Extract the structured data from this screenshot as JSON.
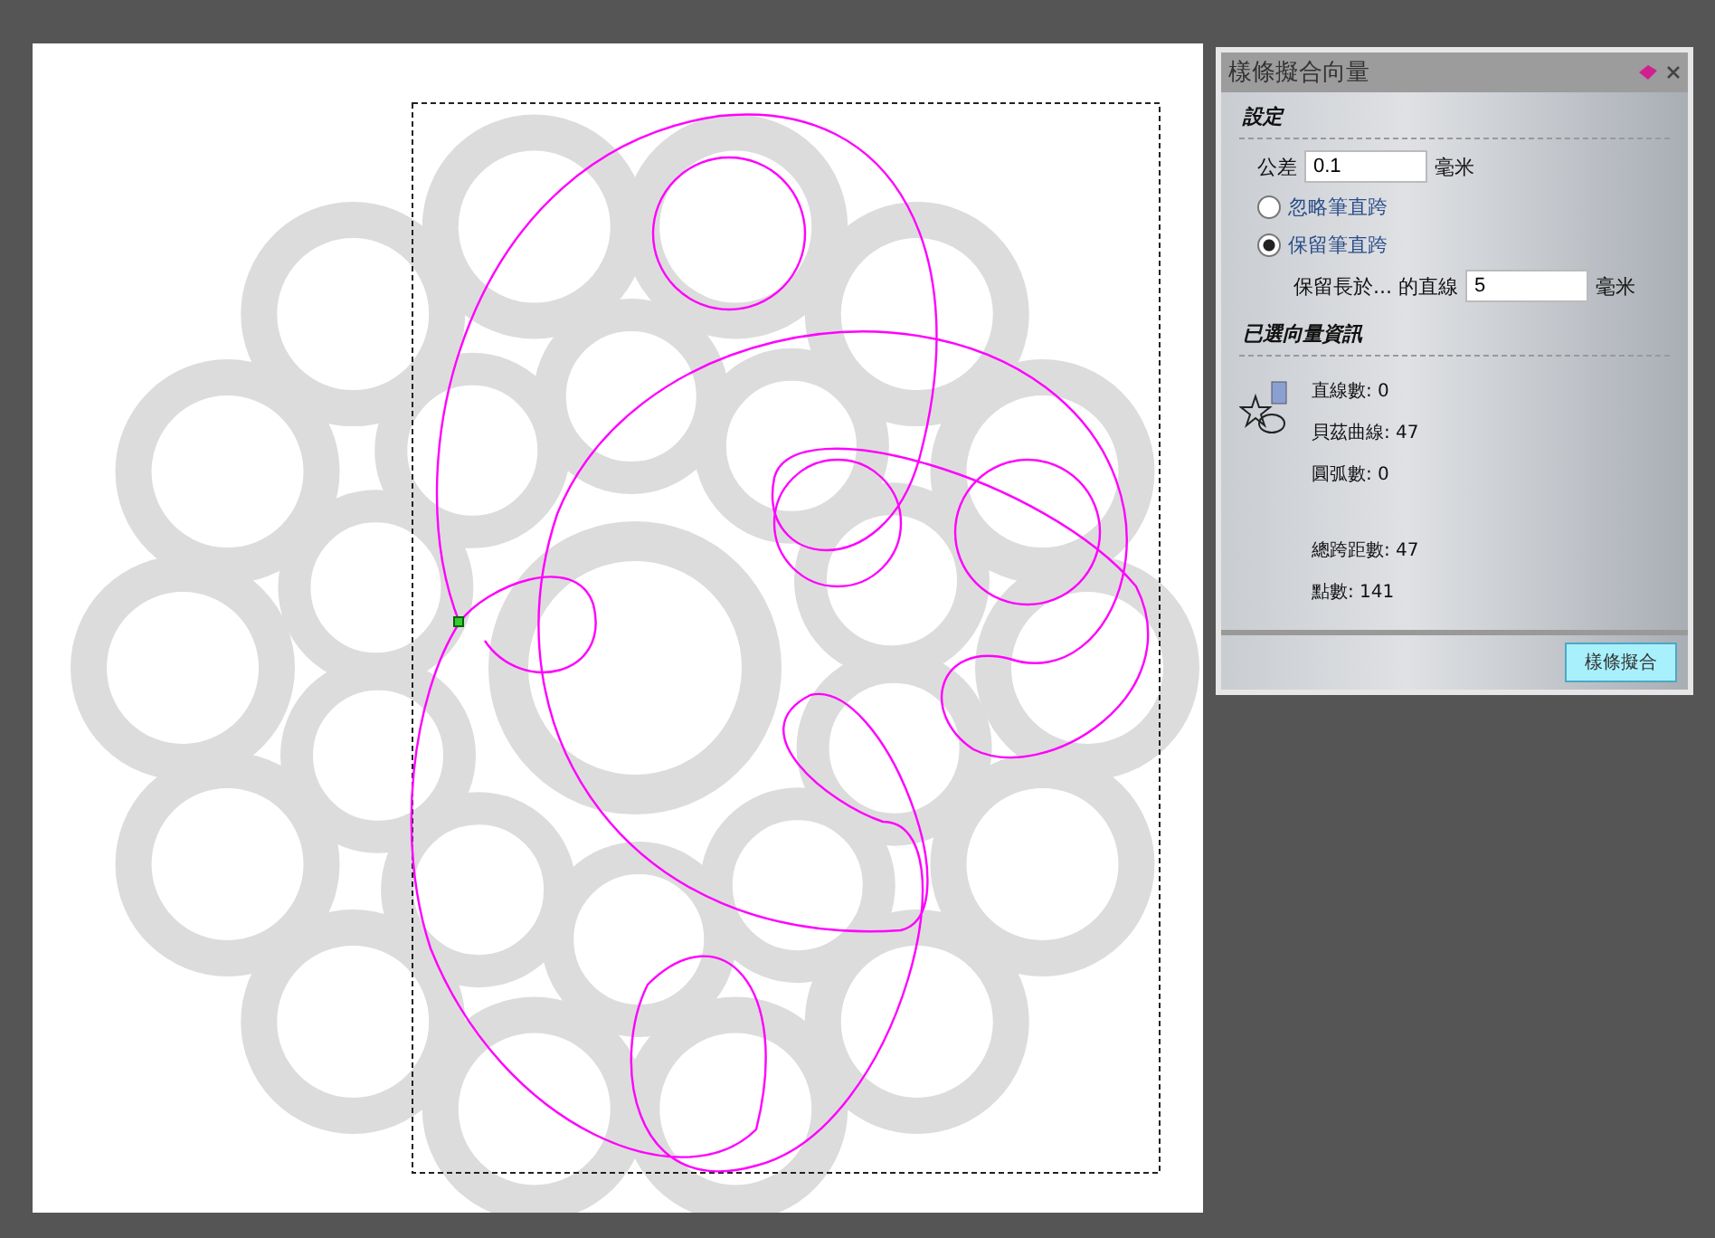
{
  "panel": {
    "title": "樣條擬合向量",
    "settings": {
      "heading": "設定",
      "tolerance": {
        "label": "公差",
        "value": "0.1",
        "unit": "毫米"
      },
      "options": [
        {
          "label": "忽略筆直跨",
          "selected": false
        },
        {
          "label": "保留筆直跨",
          "selected": true
        }
      ],
      "min_length": {
        "label": "保留長於... 的直線",
        "value": "5",
        "unit": "毫米"
      }
    },
    "info": {
      "heading": "已選向量資訊",
      "stats": [
        "直線數: 0",
        "貝茲曲線: 47",
        "圓弧數: 0"
      ],
      "totals": [
        "總跨距數: 47",
        "點數: 141"
      ]
    },
    "button": "樣條擬合"
  }
}
